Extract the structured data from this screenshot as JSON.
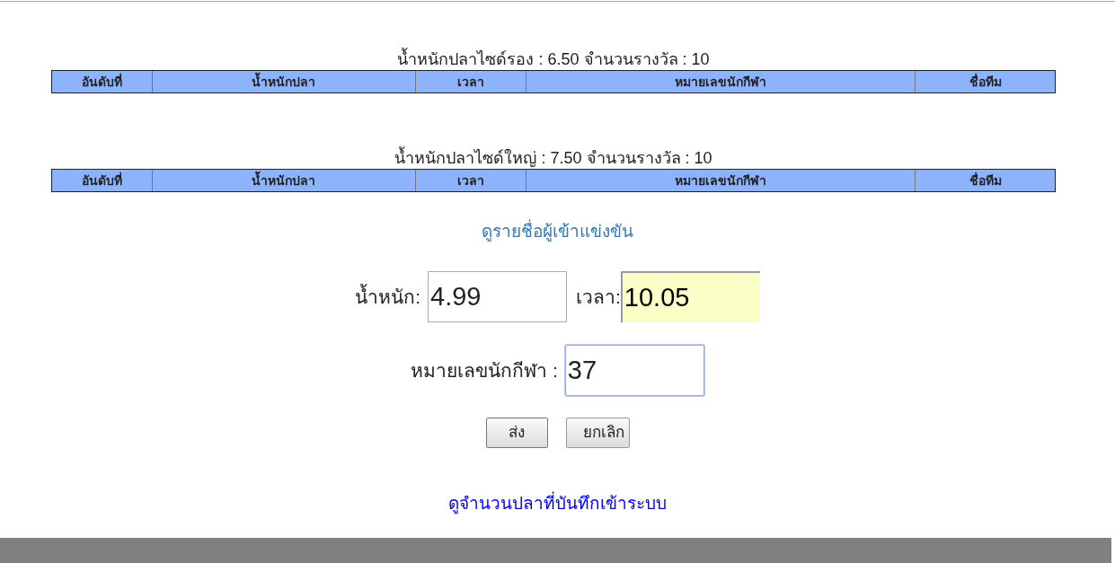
{
  "tables": [
    {
      "title": "น้ำหนักปลาไซด์รอง : 6.50 จำนวนรางวัล : 10",
      "columns": [
        "อันดับที่",
        "น้ำหนักปลา",
        "เวลา",
        "หมายเลขนักกีฬา",
        "ชื่อทีม"
      ]
    },
    {
      "title": "น้ำหนักปลาไซด์ใหญ่ : 7.50 จำนวนรางวัล : 10",
      "columns": [
        "อันดับที่",
        "น้ำหนักปลา",
        "เวลา",
        "หมายเลขนักกีฬา",
        "ชื่อทีม"
      ]
    }
  ],
  "participants_link": "ดูรายชื่อผู้เข้าแข่งขัน",
  "form": {
    "rows": [
      [
        {
          "label": "น้ำหนัก:",
          "value": "4.99",
          "highlighted": false,
          "focused": false
        },
        {
          "label": "เวลา:",
          "value": "10.05",
          "highlighted": true,
          "focused": false
        }
      ],
      [
        {
          "label": "หมายเลขนักกีฬา :",
          "value": "37",
          "highlighted": false,
          "focused": true
        }
      ]
    ],
    "buttons": [
      "ส่ง",
      "ยกเลิก"
    ]
  },
  "records_link": "ดูจำนวนปลาที่บันทึกเข้าระบบ"
}
